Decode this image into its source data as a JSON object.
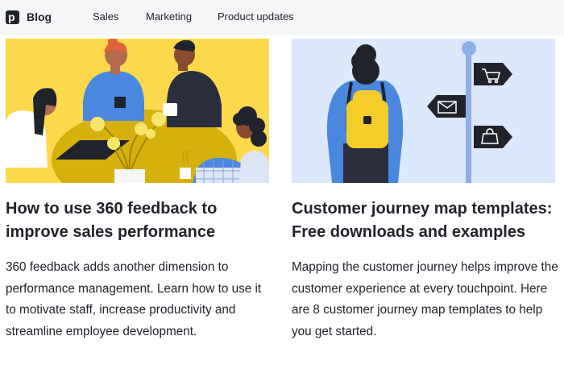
{
  "header": {
    "logo_icon": "pipedrive-p-logo-icon",
    "logo_glyph": "p",
    "brand": "Blog",
    "nav": [
      {
        "label": "Sales"
      },
      {
        "label": "Marketing"
      },
      {
        "label": "Product updates"
      }
    ]
  },
  "articles": [
    {
      "image": "team-meeting-illustration",
      "title": "How to use 360 feedback to improve sales performance",
      "description": "360 feedback adds another dimension to performance management. Learn how to use it to motivate staff, increase productivity and streamline employee development."
    },
    {
      "image": "customer-journey-signpost-illustration",
      "title": "Customer journey map templates: Free downloads and examples",
      "description": "Mapping the customer journey helps improve the customer experience at every touchpoint. Here are 8 customer journey map templates to help you get started."
    }
  ],
  "colors": {
    "header_bg": "#f5f6f8",
    "text": "#21232c",
    "card1_bg": "#fcd94a",
    "card2_bg": "#dce8fb"
  }
}
